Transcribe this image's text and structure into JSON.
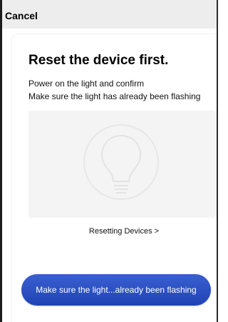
{
  "header": {
    "cancel_label": "Cancel"
  },
  "content": {
    "title": "Reset the device first.",
    "instruction_1": "Power on the light and confirm",
    "instruction_2": "Make sure the light has already been flashing",
    "illustration_icon": "lightbulb-icon",
    "resetting_link": "Resetting Devices >"
  },
  "footer": {
    "confirm_button_label": "Make sure the light...already been flashing"
  },
  "colors": {
    "header_bg": "#ededed",
    "button_blue": "#2448bf",
    "illustration_bg": "#f4f4f4"
  }
}
